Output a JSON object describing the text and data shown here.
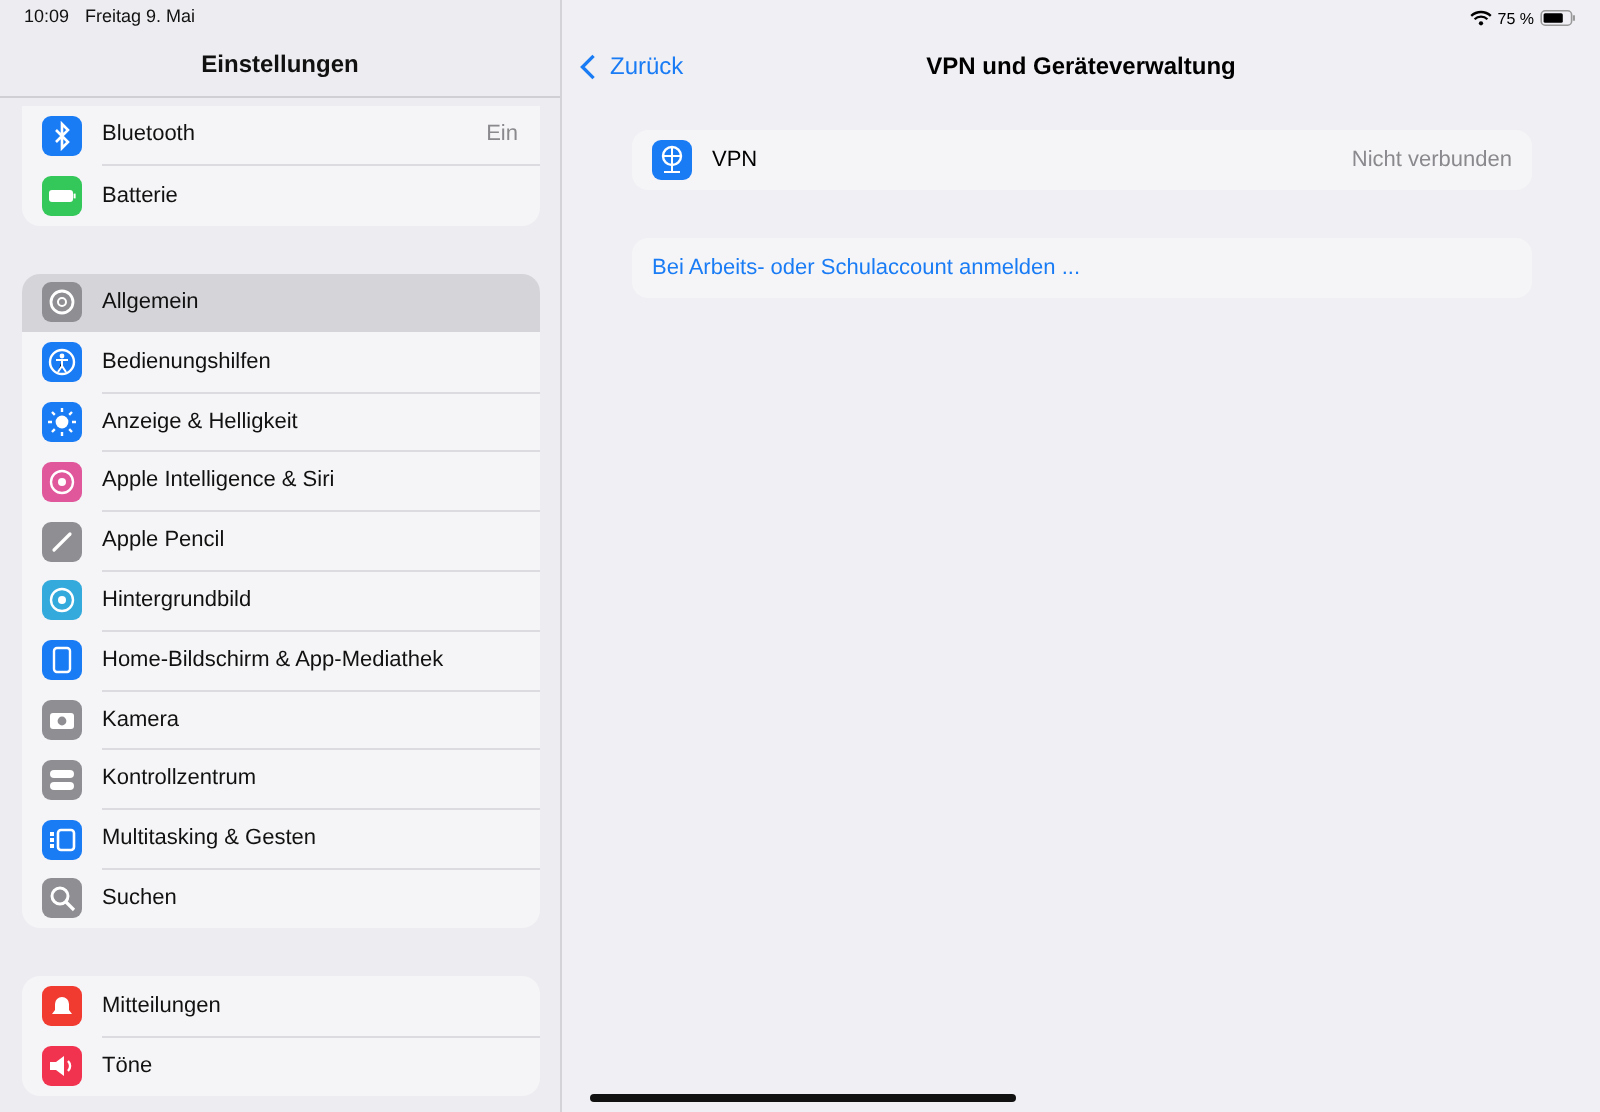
{
  "status_bar": {
    "time": "10:09",
    "date": "Freitag 9. Mai",
    "battery": "75 %"
  },
  "sidebar": {
    "title": "Einstellungen",
    "groups": [
      {
        "items": [
          {
            "label": "Bluetooth",
            "value": "Ein",
            "color": "#1a7cf5",
            "selected": false
          },
          {
            "label": "Batterie",
            "color": "#34c759",
            "selected": false
          }
        ]
      },
      {
        "items": [
          {
            "label": "Allgemein",
            "color": "#8e8e93",
            "selected": true
          },
          {
            "label": "Bedienungshilfen",
            "color": "#1a7cf5",
            "selected": false
          },
          {
            "label": "Anzeige & Helligkeit",
            "color": "#1a7cf5",
            "selected": false
          },
          {
            "label": "Apple Intelligence & Siri",
            "color": "#e0579b",
            "selected": false
          },
          {
            "label": "Apple Pencil",
            "color": "#8e8e93",
            "selected": false
          },
          {
            "label": "Hintergrundbild",
            "color": "#34aadc",
            "selected": false
          },
          {
            "label": "Home-Bildschirm & App-Mediathek",
            "color": "#1a7cf5",
            "selected": false
          },
          {
            "label": "Kamera",
            "color": "#8e8e93",
            "selected": false
          },
          {
            "label": "Kontrollzentrum",
            "color": "#8e8e93",
            "selected": false
          },
          {
            "label": "Multitasking & Gesten",
            "color": "#1a7cf5",
            "selected": false
          },
          {
            "label": "Suchen",
            "color": "#8e8e93",
            "selected": false
          }
        ]
      },
      {
        "items": [
          {
            "label": "Mitteilungen",
            "color": "#f23b30",
            "selected": false
          },
          {
            "label": "Töne",
            "color": "#f2334f",
            "selected": false
          }
        ]
      }
    ]
  },
  "detail": {
    "back": "Zurück",
    "title": "VPN und Geräteverwaltung",
    "vpn": {
      "label": "VPN",
      "status": "Nicht verbunden"
    },
    "link": "Bei Arbeits- oder Schulaccount anmelden ..."
  }
}
